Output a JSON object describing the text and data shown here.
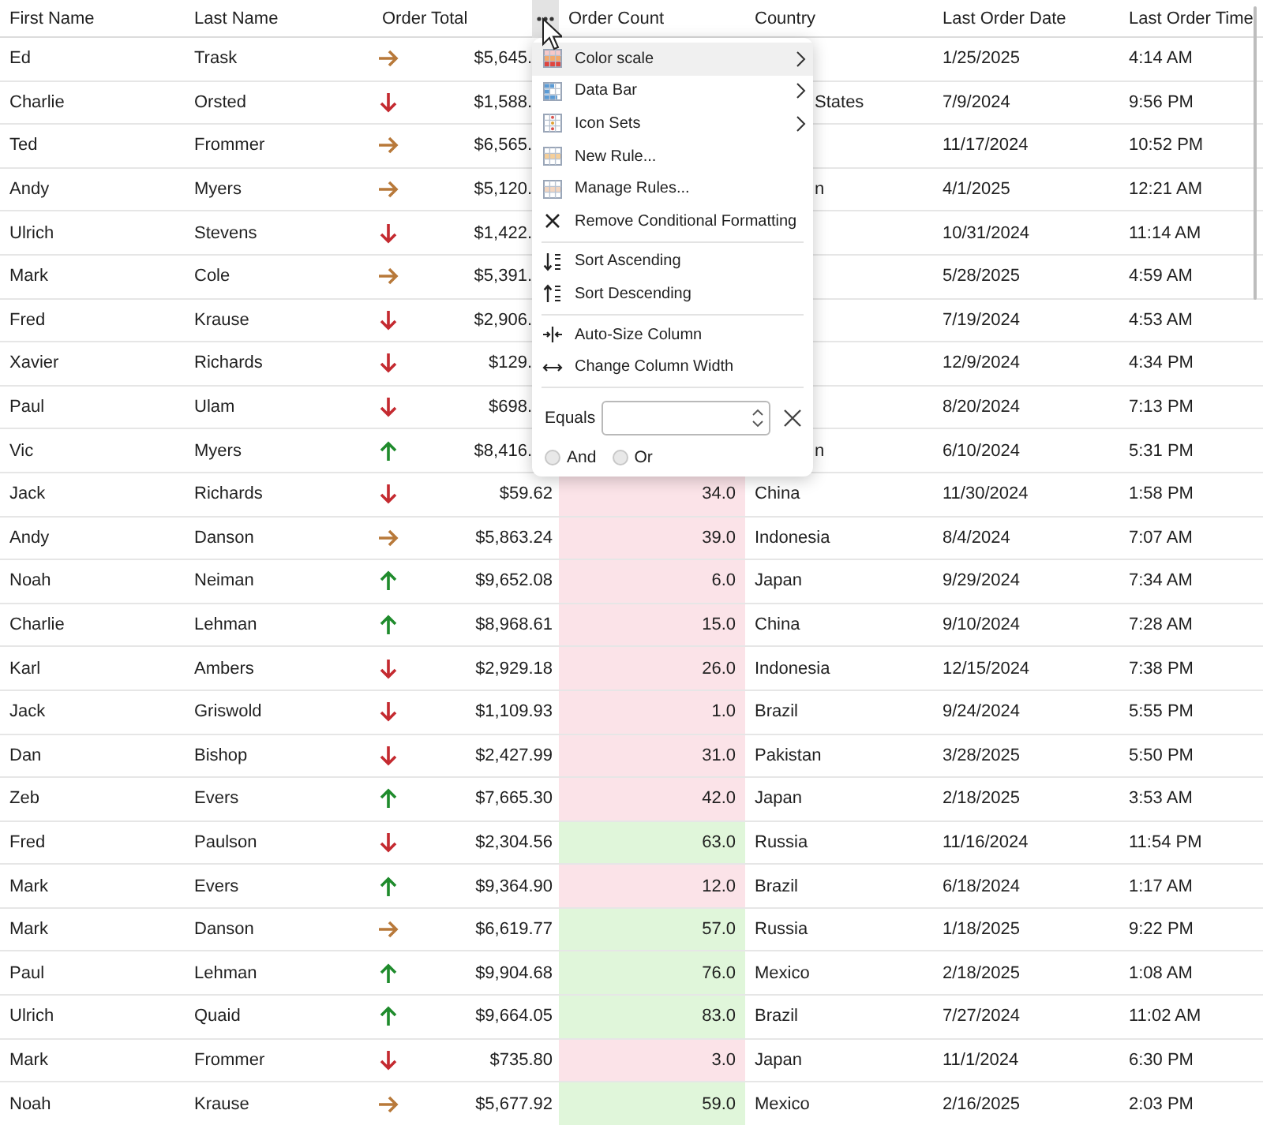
{
  "table": {
    "columns": [
      "First Name",
      "Last Name",
      "Order Total",
      "Order Count",
      "Country",
      "Last Order Date",
      "Last Order Time"
    ],
    "rows": [
      {
        "first_name": "Ed",
        "last_name": "Trask",
        "kind": "right",
        "order_total": "$5,645.",
        "last_order_date": "1/25/2025",
        "last_order_time": "4:14 AM"
      },
      {
        "first_name": "Charlie",
        "last_name": "Orsted",
        "kind": "down",
        "order_total": "$1,588.",
        "country": "States",
        "last_order_date": "7/9/2024",
        "last_order_time": "9:56 PM"
      },
      {
        "first_name": "Ted",
        "last_name": "Frommer",
        "kind": "right",
        "order_total": "$6,565.",
        "last_order_date": "11/17/2024",
        "last_order_time": "10:52 PM"
      },
      {
        "first_name": "Andy",
        "last_name": "Myers",
        "kind": "right",
        "order_total": "$5,120.",
        "country": "n",
        "last_order_date": "4/1/2025",
        "last_order_time": "12:21 AM"
      },
      {
        "first_name": "Ulrich",
        "last_name": "Stevens",
        "kind": "down",
        "order_total": "$1,422.",
        "last_order_date": "10/31/2024",
        "last_order_time": "11:14 AM"
      },
      {
        "first_name": "Mark",
        "last_name": "Cole",
        "kind": "right",
        "order_total": "$5,391.",
        "last_order_date": "5/28/2025",
        "last_order_time": "4:59 AM"
      },
      {
        "first_name": "Fred",
        "last_name": "Krause",
        "kind": "down",
        "order_total": "$2,906.",
        "last_order_date": "7/19/2024",
        "last_order_time": "4:53 AM"
      },
      {
        "first_name": "Xavier",
        "last_name": "Richards",
        "kind": "down",
        "order_total": "$129.",
        "last_order_date": "12/9/2024",
        "last_order_time": "4:34 PM"
      },
      {
        "first_name": "Paul",
        "last_name": "Ulam",
        "kind": "down",
        "order_total": "$698.",
        "last_order_date": "8/20/2024",
        "last_order_time": "7:13 PM"
      },
      {
        "first_name": "Vic",
        "last_name": "Myers",
        "kind": "up",
        "order_total": "$8,416.",
        "country": "n",
        "last_order_date": "6/10/2024",
        "last_order_time": "5:31 PM"
      },
      {
        "first_name": "Jack",
        "last_name": "Richards",
        "kind": "down",
        "order_total": "$59.62",
        "order_count": "34.0",
        "color": "#fbe3e8",
        "country": "China",
        "last_order_date": "11/30/2024",
        "last_order_time": "1:58 PM"
      },
      {
        "first_name": "Andy",
        "last_name": "Danson",
        "kind": "right",
        "order_total": "$5,863.24",
        "order_count": "39.0",
        "color": "#fbe3e8",
        "country": "Indonesia",
        "last_order_date": "8/4/2024",
        "last_order_time": "7:07 AM"
      },
      {
        "first_name": "Noah",
        "last_name": "Neiman",
        "kind": "up",
        "order_total": "$9,652.08",
        "order_count": "6.0",
        "color": "#fbe3e8",
        "country": "Japan",
        "last_order_date": "9/29/2024",
        "last_order_time": "7:34 AM"
      },
      {
        "first_name": "Charlie",
        "last_name": "Lehman",
        "kind": "up",
        "order_total": "$8,968.61",
        "order_count": "15.0",
        "color": "#fbe3e8",
        "country": "China",
        "last_order_date": "9/10/2024",
        "last_order_time": "7:28 AM"
      },
      {
        "first_name": "Karl",
        "last_name": "Ambers",
        "kind": "down",
        "order_total": "$2,929.18",
        "order_count": "26.0",
        "color": "#fbe3e8",
        "country": "Indonesia",
        "last_order_date": "12/15/2024",
        "last_order_time": "7:38 PM"
      },
      {
        "first_name": "Jack",
        "last_name": "Griswold",
        "kind": "down",
        "order_total": "$1,109.93",
        "order_count": "1.0",
        "color": "#fbe3e8",
        "country": "Brazil",
        "last_order_date": "9/24/2024",
        "last_order_time": "5:55 PM"
      },
      {
        "first_name": "Dan",
        "last_name": "Bishop",
        "kind": "down",
        "order_total": "$2,427.99",
        "order_count": "31.0",
        "color": "#fbe3e8",
        "country": "Pakistan",
        "last_order_date": "3/28/2025",
        "last_order_time": "5:50 PM"
      },
      {
        "first_name": "Zeb",
        "last_name": "Evers",
        "kind": "up",
        "order_total": "$7,665.30",
        "order_count": "42.0",
        "color": "#fbe3e8",
        "country": "Japan",
        "last_order_date": "2/18/2025",
        "last_order_time": "3:53 AM"
      },
      {
        "first_name": "Fred",
        "last_name": "Paulson",
        "kind": "down",
        "order_total": "$2,304.56",
        "order_count": "63.0",
        "color": "#e0f6da",
        "country": "Russia",
        "last_order_date": "11/16/2024",
        "last_order_time": "11:54 PM"
      },
      {
        "first_name": "Mark",
        "last_name": "Evers",
        "kind": "up",
        "order_total": "$9,364.90",
        "order_count": "12.0",
        "color": "#fbe3e8",
        "country": "Brazil",
        "last_order_date": "6/18/2024",
        "last_order_time": "1:17 AM"
      },
      {
        "first_name": "Mark",
        "last_name": "Danson",
        "kind": "right",
        "order_total": "$6,619.77",
        "order_count": "57.0",
        "color": "#e0f6da",
        "country": "Russia",
        "last_order_date": "1/18/2025",
        "last_order_time": "9:22 PM"
      },
      {
        "first_name": "Paul",
        "last_name": "Lehman",
        "kind": "up",
        "order_total": "$9,904.68",
        "order_count": "76.0",
        "color": "#e0f6da",
        "country": "Mexico",
        "last_order_date": "2/18/2025",
        "last_order_time": "1:08 AM"
      },
      {
        "first_name": "Ulrich",
        "last_name": "Quaid",
        "kind": "up",
        "order_total": "$9,664.05",
        "order_count": "83.0",
        "color": "#e0f6da",
        "country": "Brazil",
        "last_order_date": "7/27/2024",
        "last_order_time": "11:02 AM"
      },
      {
        "first_name": "Mark",
        "last_name": "Frommer",
        "kind": "down",
        "order_total": "$735.80",
        "order_count": "3.0",
        "color": "#fbe3e8",
        "country": "Japan",
        "last_order_date": "11/1/2024",
        "last_order_time": "6:30 PM"
      },
      {
        "first_name": "Noah",
        "last_name": "Krause",
        "kind": "right",
        "order_total": "$5,677.92",
        "order_count": "59.0",
        "color": "#e0f6da",
        "country": "Mexico",
        "last_order_date": "2/16/2025",
        "last_order_time": "2:03 PM"
      }
    ]
  },
  "column_menu": {
    "groups": [
      [
        {
          "label": "Color scale",
          "kind": "color_scale",
          "submenu": true,
          "selected": true
        },
        {
          "label": "Data Bar",
          "kind": "data_bar",
          "submenu": true,
          "selected": false
        },
        {
          "label": "Icon Sets",
          "kind": "icon_sets",
          "submenu": true,
          "selected": false
        },
        {
          "label": "New Rule...",
          "kind": "new_rule",
          "submenu": false,
          "selected": false
        },
        {
          "label": "Manage Rules...",
          "kind": "manage_rules",
          "submenu": false,
          "selected": false
        },
        {
          "label": "Remove Conditional Formatting",
          "kind": "remove",
          "submenu": false,
          "selected": false
        }
      ],
      [
        {
          "label": "Sort Ascending",
          "kind": "sort_asc",
          "submenu": false,
          "selected": false
        },
        {
          "label": "Sort Descending",
          "kind": "sort_desc",
          "submenu": false,
          "selected": false
        }
      ],
      [
        {
          "label": "Auto-Size Column",
          "kind": "auto_size",
          "submenu": false,
          "selected": false
        },
        {
          "label": "Change Column Width",
          "kind": "change_width",
          "submenu": false,
          "selected": false
        }
      ]
    ],
    "filter": {
      "label": "Equals",
      "options": [
        {
          "label": "And",
          "selected": false
        },
        {
          "label": "Or",
          "selected": false
        }
      ]
    }
  }
}
